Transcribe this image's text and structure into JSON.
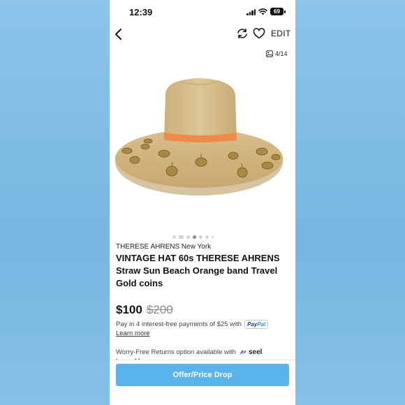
{
  "status_bar": {
    "time": "12:39",
    "battery": "69"
  },
  "nav": {
    "edit_label": "EDIT"
  },
  "gallery": {
    "counter": "4/14",
    "current_index": 4,
    "total": 14
  },
  "product": {
    "brand": "THERESE AHRENS New York",
    "title": "VINTAGE HAT 60s THERESE AHRENS Straw Sun Beach Orange band Travel Gold coins",
    "price": "$100",
    "original_price": "$200"
  },
  "payments": {
    "installments_text": "Pay in 4 interest-free payments of $25 with",
    "paypal_part1": "Pay",
    "paypal_part2": "Pal",
    "learn_more": "Learn more"
  },
  "returns": {
    "text": "Worry-Free Returns option available with",
    "provider": "seel",
    "partial_link": "Learn More"
  },
  "actions": {
    "offer_button": "Offer/Price Drop"
  },
  "colors": {
    "accent": "#5ab3e9",
    "background": "#7fbbe3",
    "hat_band": "#f08a4b",
    "hat_straw": "#d8bf8c"
  }
}
